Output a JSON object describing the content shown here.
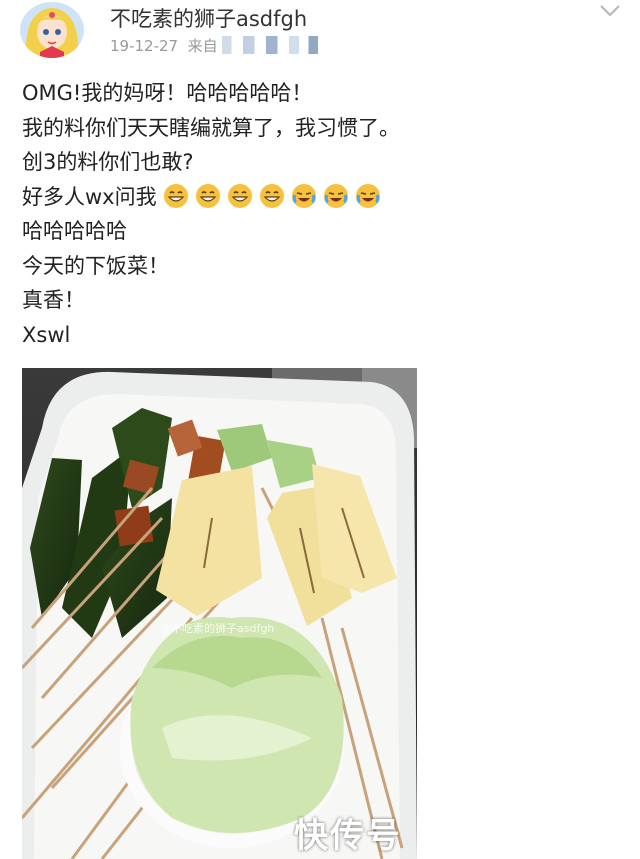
{
  "post": {
    "author": "不吃素的狮子asdfgh",
    "date": "19-12-27",
    "source_prefix": "来自",
    "lines": [
      "OMG!我的妈呀！哈哈哈哈哈！",
      "我的料你们天天瞎编就算了，我习惯了。",
      "创3的料你们也敢?",
      "好多人wx问我",
      "哈哈哈哈哈",
      "今天的下饭菜！",
      "真香！",
      "Xswl"
    ],
    "emojis": [
      "grin-emoji",
      "grin-emoji",
      "grin-emoji",
      "grin-emoji",
      "laugh-cry-emoji",
      "laugh-cry-emoji",
      "laugh-cry-emoji"
    ],
    "photo_watermark": "@不吃素的狮子asdfgh"
  },
  "watermark": "快传号",
  "colors": {
    "text": "#222222",
    "meta": "#999999",
    "emoji_face": "#f6c23e"
  }
}
